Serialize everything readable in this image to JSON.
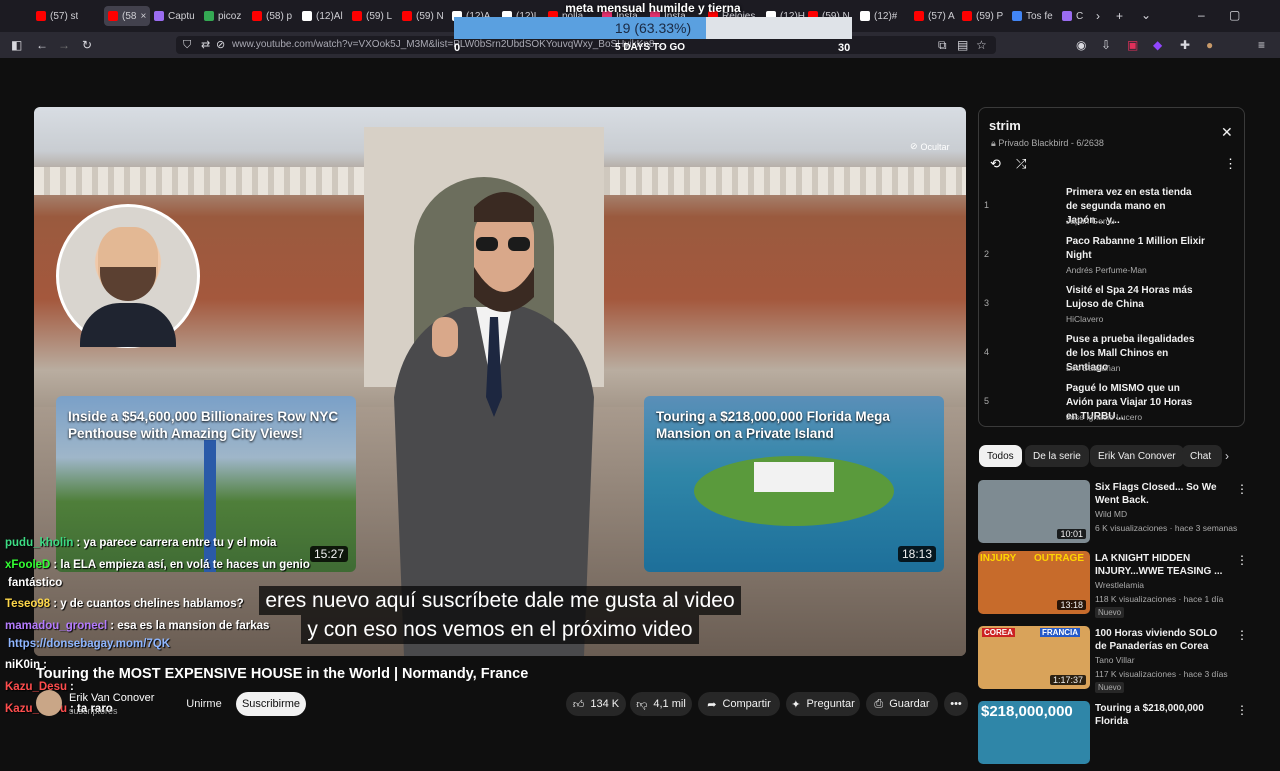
{
  "browser": {
    "tabs": [
      {
        "label": "(57) st",
        "color": "#ff0000"
      },
      {
        "label": "(58",
        "color": "#ff0000",
        "active": true
      },
      {
        "label": "Captu",
        "color": "#9a6cf0"
      },
      {
        "label": "picoz",
        "color": "#34a853"
      },
      {
        "label": "(58) p",
        "color": "#ff0000"
      },
      {
        "label": "(12)Al",
        "color": "#ffffff"
      },
      {
        "label": "(59) L",
        "color": "#ff0000"
      },
      {
        "label": "(59) N",
        "color": "#ff0000"
      },
      {
        "label": "(12)A",
        "color": "#ffffff"
      },
      {
        "label": "(12)L",
        "color": "#ffffff"
      },
      {
        "label": "polla",
        "color": "#ff0000"
      },
      {
        "label": "Insta",
        "color": "#e1306c"
      },
      {
        "label": "Insta",
        "color": "#e1306c"
      },
      {
        "label": "Relojes",
        "color": "#ff0000"
      },
      {
        "label": "(12)H",
        "color": "#ffffff"
      },
      {
        "label": "(59) N",
        "color": "#ff0000"
      },
      {
        "label": "(12)#",
        "color": "#ffffff"
      },
      {
        "label": "(57) A",
        "color": "#ff0000"
      },
      {
        "label": "(59) P",
        "color": "#ff0000"
      },
      {
        "label": "Tos fe",
        "color": "#4285f4"
      },
      {
        "label": "C",
        "color": "#9a6cf0"
      }
    ],
    "url": "www.youtube.com/watch?v=VXOok5J_M3M&list=PLW0bSrn2UbdSOKYouvqWxy_BoSHyikKn8..."
  },
  "goal": {
    "title": "meta mensual humilde y tierna",
    "percent_label": "19 (63.33%)",
    "progress": 0.6333,
    "min": "0",
    "max": "30",
    "days_left": "5 DAYS TO GO",
    "fill_color": "#5aa0e0"
  },
  "video": {
    "hide_label": "Ocultar",
    "endcards": [
      {
        "title": "Inside a $54,600,000 Billionaires Row NYC Penthouse with Amazing City Views!",
        "duration": "15:27"
      },
      {
        "title": "Touring a $218,000,000 Florida Mega Mansion on a Private Island",
        "duration": "18:13"
      }
    ],
    "subtitles": [
      "eres nuevo aquí suscríbete dale me gusta al video",
      "y con eso nos vemos en el próximo video"
    ]
  },
  "chat": [
    {
      "user": "pudu_kholin",
      "color": "#3ddc84",
      "text": ": ya parece carrera entre tu y el moia"
    },
    {
      "user": "xFooleD",
      "color": "#33ff33",
      "text": ": la ELA empieza así, en volá te haces un genio"
    },
    {
      "user": "",
      "color": "#ffffff",
      "text": "fantástico"
    },
    {
      "user": "Teseo98",
      "color": "#ffd84a",
      "text": ": y de cuantos chelines hablamos?"
    },
    {
      "user": "mamadou_gronecl",
      "color": "#b57cff",
      "text": ": esa es la mansion de farkas"
    },
    {
      "user": "",
      "color": "#8fb6ff",
      "text": "https://donsebagay.mom/7QK"
    },
    {
      "user": "niK0in",
      "color": "#ffffff",
      "text": ":"
    },
    {
      "user": "Kazu_Desu",
      "color": "#ff4d4d",
      "text": ":"
    },
    {
      "user": "Kazu_Desu",
      "color": "#ff4d4d",
      "text": ": ta raro"
    }
  ],
  "below": {
    "title": "Touring the MOST EXPENSIVE HOUSE in the World | Normandy, France",
    "channel": "Erik Van Conover",
    "subs": "suscriptores",
    "unsubscribe": "Unirme",
    "subscribe": "Suscribirme",
    "likes": "134 K",
    "dislikes": "4,1 mil",
    "share": "Compartir",
    "ask": "Preguntar",
    "save": "Guardar"
  },
  "playlist": {
    "title": "strim",
    "meta": "Privado Blackbird - 6/2638",
    "items": [
      {
        "n": "1",
        "title": "Primera vez en esta tienda de segunda mano en Japón... y...",
        "channel": "Japan Gemu"
      },
      {
        "n": "2",
        "title": "Paco Rabanne 1 Million Elixir Night",
        "channel": "Andrés Perfume-Man"
      },
      {
        "n": "3",
        "title": "Visité el Spa 24 Horas más Lujoso de China",
        "channel": "HiClavero"
      },
      {
        "n": "4",
        "title": "Puse a prueba ilegalidades de los Mall Chinos en Santiago",
        "channel": "Leo Bascuñan"
      },
      {
        "n": "5",
        "title": "Pagué lo MISMO que un Avión para Viajar 10 Horas en TURBU...",
        "channel": "Jose Ignacio Lucero"
      }
    ]
  },
  "chips": [
    "Todos",
    "De la serie",
    "Erik Van Conover",
    "Chat"
  ],
  "recs": [
    {
      "title": "Six Flags Closed... So We Went Back.",
      "channel": "Wild MD",
      "meta": "6 K visualizaciones · hace 3 semanas",
      "duration": "10:01",
      "badge": "",
      "bg": "#7e8b92"
    },
    {
      "title": "LA KNIGHT HIDDEN INJURY...WWE TEASING ...",
      "channel": "Wrestlelamia",
      "meta": "118 K visualizaciones · hace 1 día",
      "duration": "13:18",
      "badge": "Nuevo",
      "bg": "#c76b2b"
    },
    {
      "title": "100 Horas viviendo SOLO de Panaderías en Corea",
      "channel": "Tano Villar",
      "meta": "117 K visualizaciones · hace 3 días",
      "duration": "1:17:37",
      "badge": "Nuevo",
      "bg": "#d9a35a"
    },
    {
      "title": "Touring a $218,000,000 Florida",
      "channel": "",
      "meta": "",
      "duration": "",
      "badge": "",
      "bg": "#2f86a8",
      "overlay": "$218,000,000"
    }
  ],
  "thumb_labels": [
    "COREA",
    "FRANCIA",
    "INJURY",
    "OUTRAGE"
  ]
}
